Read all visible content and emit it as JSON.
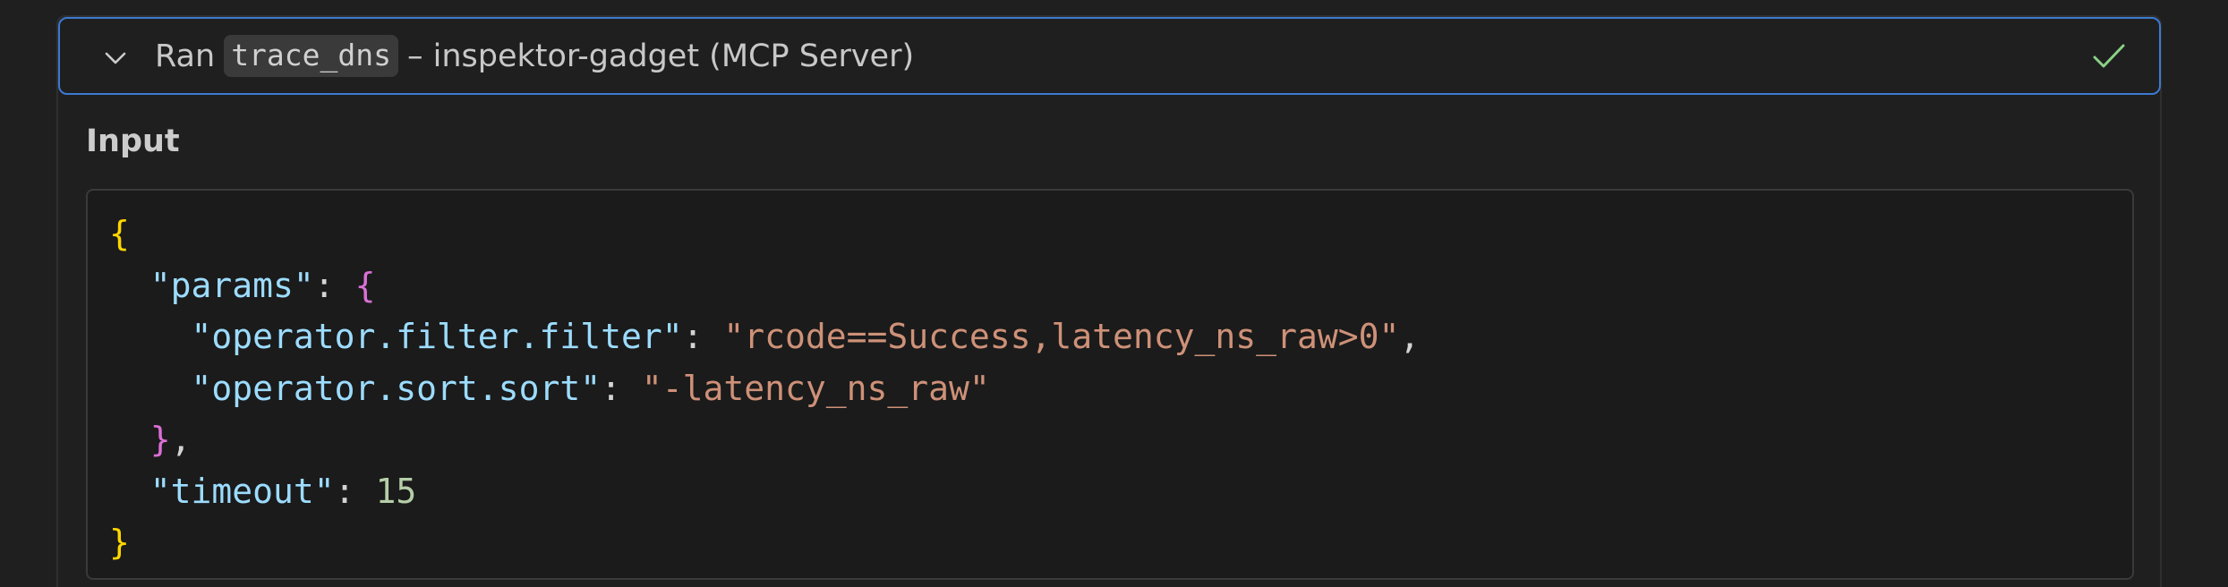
{
  "tool_call": {
    "prefix": "Ran",
    "tool_name": "trace_dns",
    "suffix": "– inspektor-gadget (MCP Server)",
    "status_icon": "checkmark-icon",
    "expand_icon": "chevron-down-icon"
  },
  "input_section": {
    "label": "Input"
  },
  "code": {
    "open_brace": "{",
    "params_key": "\"params\"",
    "colon": ": ",
    "params_open": "{",
    "filter_key": "\"operator.filter.filter\"",
    "filter_value": "\"rcode==Success,latency_ns_raw>0\"",
    "comma": ",",
    "sort_key": "\"operator.sort.sort\"",
    "sort_value": "\"-latency_ns_raw\"",
    "params_close": "}",
    "timeout_key": "\"timeout\"",
    "timeout_value": "15",
    "close_brace": "}"
  },
  "colors": {
    "header_border": "#3b7ad1",
    "check": "#89d185",
    "bracket_level1": "#ffd700",
    "bracket_level2": "#da70d6",
    "json_key": "#9cdcfe",
    "json_string": "#ce9178",
    "json_number": "#b5cea8"
  }
}
